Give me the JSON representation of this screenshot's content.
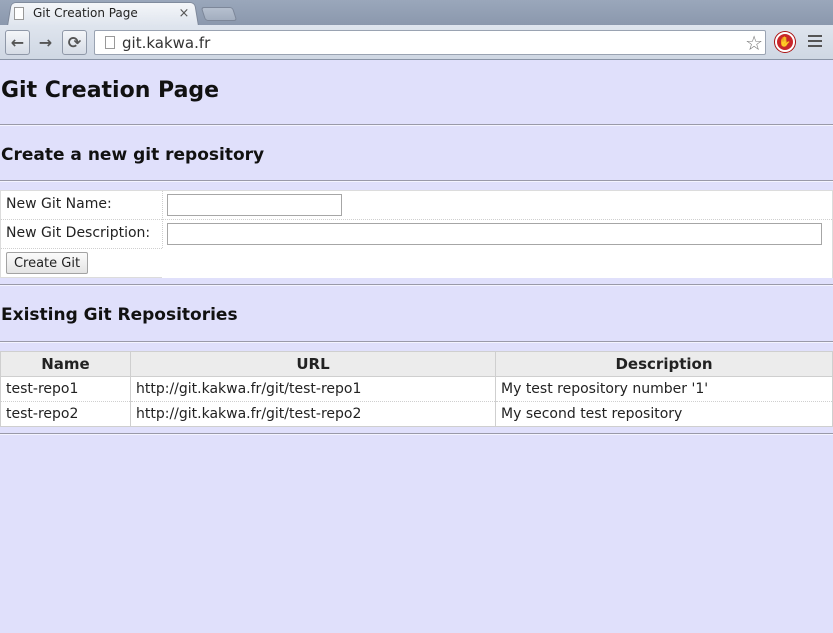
{
  "browser": {
    "tab_title": "Git Creation Page",
    "tab_close": "×",
    "url": "git.kakwa.fr",
    "back_icon": "←",
    "forward_icon": "→",
    "reload_icon": "⟳",
    "star_icon": "☆"
  },
  "page": {
    "title": "Git Creation Page",
    "create_section_title": "Create a new git repository",
    "form": {
      "name_label": "New Git Name:",
      "name_value": "",
      "description_label": "New Git Description:",
      "description_value": "",
      "submit_label": "Create Git"
    },
    "existing_section_title": "Existing Git Repositories",
    "table": {
      "headers": [
        "Name",
        "URL",
        "Description"
      ],
      "rows": [
        {
          "name": "test-repo1",
          "url": "http://git.kakwa.fr/git/test-repo1",
          "description": "My test repository number '1'"
        },
        {
          "name": "test-repo2",
          "url": "http://git.kakwa.fr/git/test-repo2",
          "description": "My second test repository"
        }
      ]
    }
  }
}
